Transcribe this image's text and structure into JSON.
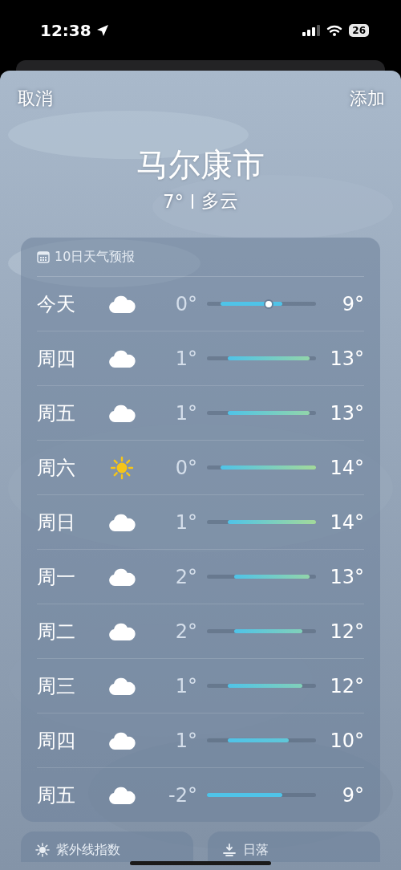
{
  "status_bar": {
    "time": "12:38",
    "battery": "26"
  },
  "nav": {
    "cancel": "取消",
    "add": "添加"
  },
  "location": {
    "city": "马尔康市",
    "temperature": "7°",
    "condition": "多云"
  },
  "forecast": {
    "title": "10日天气预报",
    "days": [
      {
        "day": "今天",
        "kind": "cloud",
        "low": "0°",
        "high": "9°",
        "current_marker": true
      },
      {
        "day": "周四",
        "kind": "cloud",
        "low": "1°",
        "high": "13°",
        "current_marker": false
      },
      {
        "day": "周五",
        "kind": "cloud",
        "low": "1°",
        "high": "13°",
        "current_marker": false
      },
      {
        "day": "周六",
        "kind": "sun",
        "low": "0°",
        "high": "14°",
        "current_marker": false
      },
      {
        "day": "周日",
        "kind": "cloud",
        "low": "1°",
        "high": "14°",
        "current_marker": false
      },
      {
        "day": "周一",
        "kind": "cloud",
        "low": "2°",
        "high": "13°",
        "current_marker": false
      },
      {
        "day": "周二",
        "kind": "cloud",
        "low": "2°",
        "high": "12°",
        "current_marker": false
      },
      {
        "day": "周三",
        "kind": "cloud",
        "low": "1°",
        "high": "12°",
        "current_marker": false
      },
      {
        "day": "周四",
        "kind": "cloud",
        "low": "1°",
        "high": "10°",
        "current_marker": false
      },
      {
        "day": "周五",
        "kind": "cloud",
        "low": "-2°",
        "high": "9°",
        "current_marker": false
      }
    ]
  },
  "cards": [
    {
      "kind": "sun",
      "title": "紫外线指数"
    },
    {
      "kind": "sunset",
      "title": "日落"
    }
  ]
}
